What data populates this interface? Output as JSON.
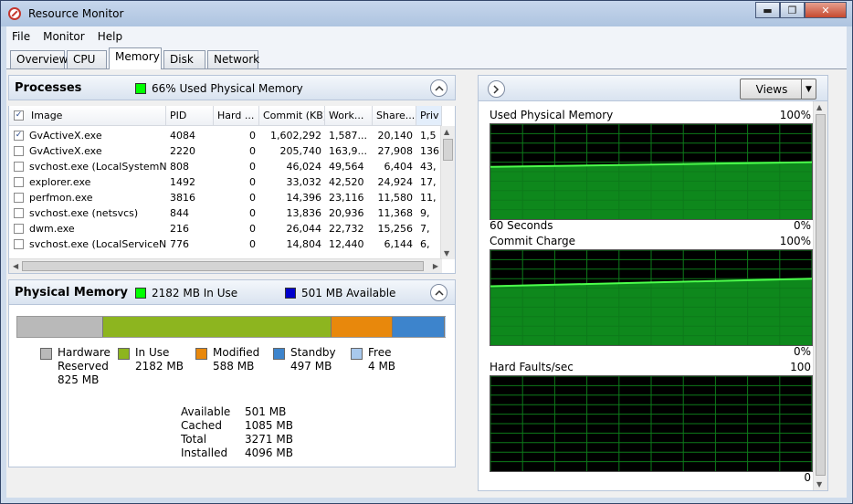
{
  "window": {
    "title": "Resource Monitor",
    "minimize_glyph": "▬",
    "restore_glyph": "❐",
    "close_glyph": "✕"
  },
  "menu": [
    "File",
    "Monitor",
    "Help"
  ],
  "tabs": [
    "Overview",
    "CPU",
    "Memory",
    "Disk",
    "Network"
  ],
  "active_tab": "Memory",
  "processes": {
    "title": "Processes",
    "summary": "66% Used Physical Memory",
    "summary_color": "#00ff00",
    "columns": [
      "Image",
      "PID",
      "Hard ...",
      "Commit (KB)",
      "Work...",
      "Share...",
      "Priv"
    ],
    "rows": [
      {
        "checked": true,
        "image": "GvActiveX.exe",
        "pid": "4084",
        "hard": "0",
        "commit": "1,602,292",
        "work": "1,587...",
        "share": "20,140",
        "priv": "1,5"
      },
      {
        "checked": false,
        "image": "GvActiveX.exe",
        "pid": "2220",
        "hard": "0",
        "commit": "205,740",
        "work": "163,9...",
        "share": "27,908",
        "priv": "136"
      },
      {
        "checked": false,
        "image": "svchost.exe (LocalSystemN...",
        "pid": "808",
        "hard": "0",
        "commit": "46,024",
        "work": "49,564",
        "share": "6,404",
        "priv": "43,"
      },
      {
        "checked": false,
        "image": "explorer.exe",
        "pid": "1492",
        "hard": "0",
        "commit": "33,032",
        "work": "42,520",
        "share": "24,924",
        "priv": "17,"
      },
      {
        "checked": false,
        "image": "perfmon.exe",
        "pid": "3816",
        "hard": "0",
        "commit": "14,396",
        "work": "23,116",
        "share": "11,580",
        "priv": "11,"
      },
      {
        "checked": false,
        "image": "svchost.exe (netsvcs)",
        "pid": "844",
        "hard": "0",
        "commit": "13,836",
        "work": "20,936",
        "share": "11,368",
        "priv": "9,"
      },
      {
        "checked": false,
        "image": "dwm.exe",
        "pid": "216",
        "hard": "0",
        "commit": "26,044",
        "work": "22,732",
        "share": "15,256",
        "priv": "7,"
      },
      {
        "checked": false,
        "image": "svchost.exe (LocalServiceN...",
        "pid": "776",
        "hard": "0",
        "commit": "14,804",
        "work": "12,440",
        "share": "6,144",
        "priv": "6,"
      }
    ]
  },
  "physical_memory": {
    "title": "Physical Memory",
    "in_use_label": "2182 MB In Use",
    "available_label": "501 MB Available",
    "in_use_color": "#00ff00",
    "available_color": "#0000cc",
    "bar_segments": [
      {
        "name": "hardware",
        "mb": 825,
        "color": "#b9b9b9"
      },
      {
        "name": "in-use",
        "mb": 2182,
        "color": "#8db51f"
      },
      {
        "name": "modified",
        "mb": 588,
        "color": "#e8880c"
      },
      {
        "name": "standby",
        "mb": 497,
        "color": "#3d84cc"
      },
      {
        "name": "free",
        "mb": 4,
        "color": "#a8c8ec"
      }
    ],
    "legend": [
      {
        "name": "Hardware Reserved",
        "line1": "Hardware",
        "line2": "Reserved",
        "value": "825 MB",
        "color": "#b9b9b9"
      },
      {
        "name": "In Use",
        "line1": "In Use",
        "line2": "2182 MB",
        "value": "",
        "color": "#8db51f"
      },
      {
        "name": "Modified",
        "line1": "Modified",
        "line2": "588 MB",
        "value": "",
        "color": "#e8880c"
      },
      {
        "name": "Standby",
        "line1": "Standby",
        "line2": "497 MB",
        "value": "",
        "color": "#3d84cc"
      },
      {
        "name": "Free",
        "line1": "Free",
        "line2": "4 MB",
        "value": "",
        "color": "#a8c8ec"
      }
    ],
    "stats": [
      {
        "label": "Available",
        "value": "501 MB"
      },
      {
        "label": "Cached",
        "value": "1085 MB"
      },
      {
        "label": "Total",
        "value": "3271 MB"
      },
      {
        "label": "Installed",
        "value": "4096 MB"
      }
    ]
  },
  "graphs": {
    "views_label": "Views",
    "used_physical": {
      "title": "Used Physical Memory",
      "max": "100%",
      "min": "0%",
      "time": "60 Seconds",
      "start_pct": 55,
      "end_pct": 60
    },
    "commit_charge": {
      "title": "Commit Charge",
      "max": "100%",
      "min": "0%",
      "start_pct": 62,
      "end_pct": 70
    },
    "hard_faults": {
      "title": "Hard Faults/sec",
      "max": "100",
      "min": "0"
    }
  }
}
